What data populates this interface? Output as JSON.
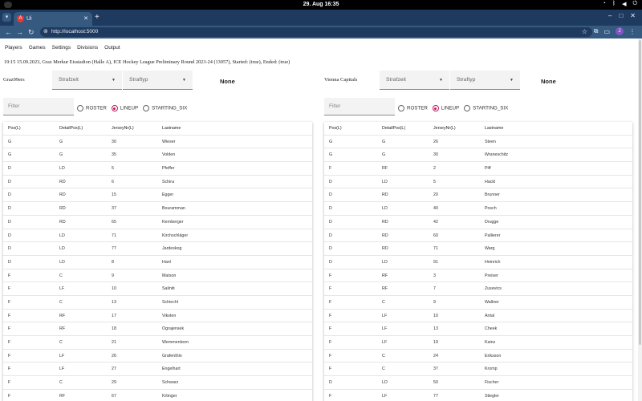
{
  "os": {
    "clock": "29. Aug 16:35"
  },
  "browser": {
    "tab_title": "Ui",
    "url": "http://localhost:5000"
  },
  "menu": [
    "Players",
    "Games",
    "Settings",
    "Divisions",
    "Output"
  ],
  "game_info": "19:15 15.09.2023, Graz Merkur Eisstadion (Halle A), ICE Hockey League Preliminary Round 2023-24 (13057), Started: (true), Ended: (true)",
  "common": {
    "strafzeit": "Strafzeit",
    "straftyp": "Straftyp",
    "none": "None",
    "filter_placeholder": "Filter",
    "roster": "ROSTER",
    "lineup": "LINEUP",
    "starting_six": "STARTING_SIX",
    "headers": [
      "Pos(L)",
      "DetailPos(L)",
      "JerseyNr(L)",
      "Lastname"
    ]
  },
  "teams": [
    {
      "name": "Graz99ers",
      "selected_mode": "LINEUP",
      "rows": [
        [
          "G",
          "G",
          "30",
          "Wieser"
        ],
        [
          "G",
          "G",
          "35",
          "Volden"
        ],
        [
          "D",
          "LD",
          "5",
          "Pfeffer"
        ],
        [
          "D",
          "RD",
          "6",
          "Schira"
        ],
        [
          "D",
          "RD",
          "15",
          "Egger"
        ],
        [
          "D",
          "RD",
          "37",
          "Bouramman"
        ],
        [
          "D",
          "RD",
          "65",
          "Kernberger"
        ],
        [
          "D",
          "LD",
          "71",
          "Kirchschläger"
        ],
        [
          "D",
          "LD",
          "77",
          "Jardeskog"
        ],
        [
          "D",
          "LD",
          "8",
          "Hanl"
        ],
        [
          "F",
          "C",
          "9",
          "Matson"
        ],
        [
          "F",
          "LF",
          "10",
          "Saliniti"
        ],
        [
          "F",
          "C",
          "13",
          "Schiechl"
        ],
        [
          "F",
          "RF",
          "17",
          "Viksten"
        ],
        [
          "F",
          "RF",
          "18",
          "Ograjensek"
        ],
        [
          "F",
          "C",
          "21",
          "Wemmenborn"
        ],
        [
          "F",
          "LF",
          "26",
          "Grafenthin"
        ],
        [
          "F",
          "LF",
          "27",
          "Engelhart"
        ],
        [
          "F",
          "C",
          "29",
          "Schwarz"
        ],
        [
          "F",
          "RF",
          "67",
          "Krtinger"
        ]
      ]
    },
    {
      "name": "Vienna Capitals",
      "selected_mode": "LINEUP",
      "rows": [
        [
          "G",
          "G",
          "26",
          "Steen"
        ],
        [
          "G",
          "G",
          "30",
          "Wraneschitz"
        ],
        [
          "F",
          "RF",
          "2",
          "Piff"
        ],
        [
          "D",
          "LD",
          "5",
          "Hackl"
        ],
        [
          "D",
          "RD",
          "20",
          "Brunner"
        ],
        [
          "D",
          "LD",
          "40",
          "Posch"
        ],
        [
          "D",
          "RD",
          "42",
          "Drugge"
        ],
        [
          "D",
          "RD",
          "60",
          "Pallierer"
        ],
        [
          "D",
          "RD",
          "71",
          "Warg"
        ],
        [
          "D",
          "LD",
          "91",
          "Heinrich"
        ],
        [
          "F",
          "RF",
          "3",
          "Preiser"
        ],
        [
          "F",
          "RF",
          "7",
          "Zusevics"
        ],
        [
          "F",
          "C",
          "9",
          "Wallner"
        ],
        [
          "F",
          "LF",
          "10",
          "Antal"
        ],
        [
          "F",
          "LF",
          "13",
          "Cheek"
        ],
        [
          "F",
          "LF",
          "19",
          "Kainz"
        ],
        [
          "F",
          "C",
          "24",
          "Eriksson"
        ],
        [
          "F",
          "C",
          "37",
          "Kromp"
        ],
        [
          "D",
          "LD",
          "50",
          "Fischer"
        ],
        [
          "F",
          "LF",
          "77",
          "Stiegler"
        ]
      ]
    }
  ]
}
